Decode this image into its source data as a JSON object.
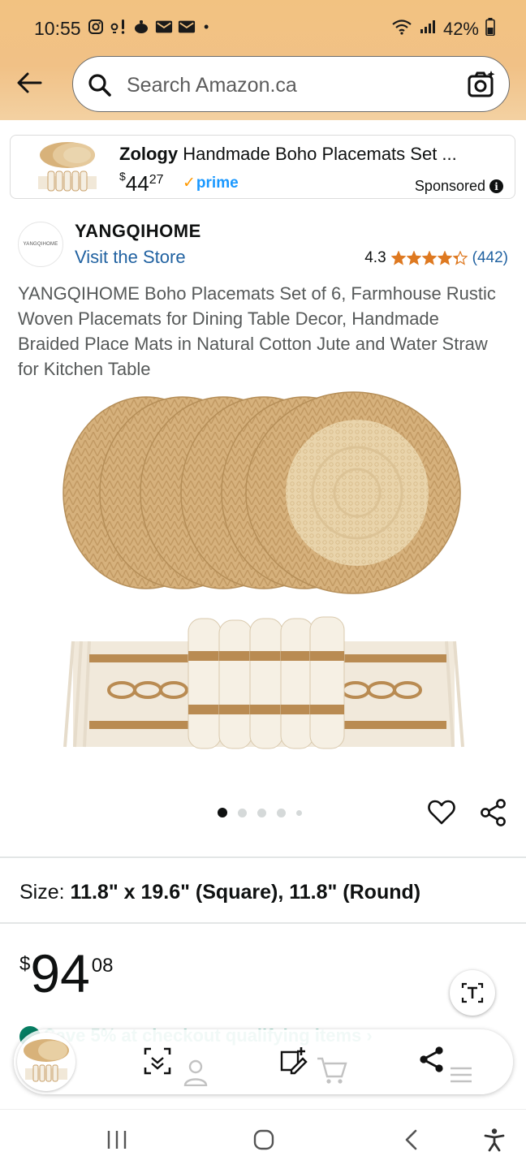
{
  "status_bar": {
    "time": "10:55",
    "battery": "42%"
  },
  "search": {
    "placeholder": "Search Amazon.ca"
  },
  "sponsored_ad": {
    "brand": "Zology",
    "title": "Handmade Boho Placemats Set ...",
    "price_currency": "$",
    "price_whole": "44",
    "price_fraction": "27",
    "prime_label": "prime",
    "sponsored_label": "Sponsored"
  },
  "product": {
    "brand_logo_text": "YANGQIHOME",
    "brand": "YANGQIHOME",
    "visit_store": "Visit the Store",
    "rating": "4.3",
    "rating_value": 4.3,
    "rating_count": "(442)",
    "title": "YANGQIHOME Boho Placemats Set of 6, Farmhouse Rustic Woven Placemats for Dining Table Decor, Handmade Braided Place Mats in Natural Cotton Jute and Water Straw for Kitchen Table",
    "image_count": 5,
    "active_image": 1,
    "size_label": "Size:",
    "size_value": "11.8\" x 19.6\" (Square), 11.8\" (Round)",
    "price_currency": "$",
    "price_whole": "94",
    "price_fraction": "08"
  },
  "promo": {
    "text": "Save 5% at checkout  qualifying items ›"
  },
  "colors": {
    "header_bg": "#f2c281",
    "link": "#2162a1",
    "star": "#de7921",
    "prime": "#1a98ff"
  }
}
